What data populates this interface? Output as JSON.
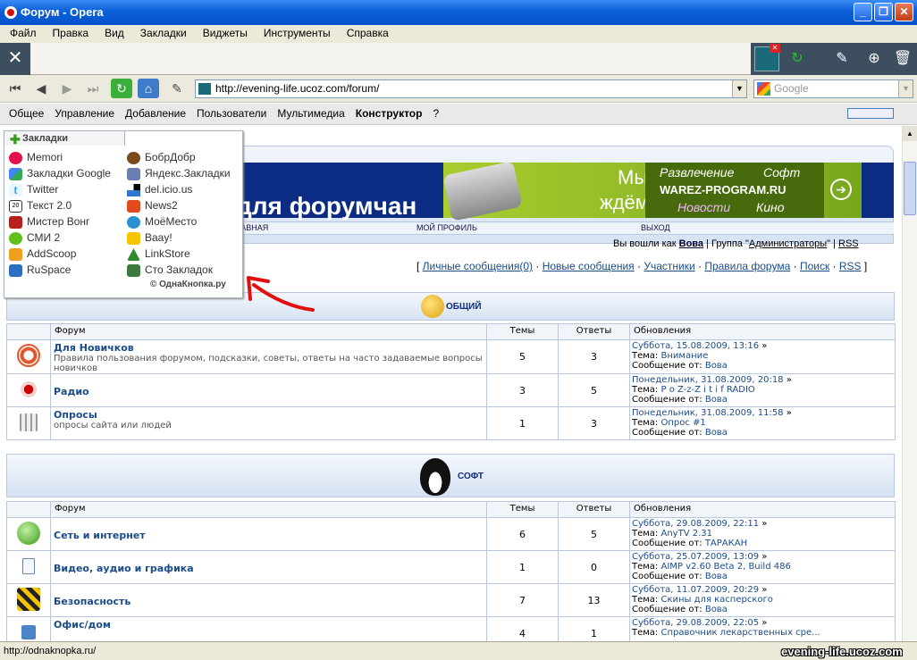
{
  "window": {
    "title": "Форум - Opera"
  },
  "menu": [
    "Файл",
    "Правка",
    "Вид",
    "Закладки",
    "Виджеты",
    "Инструменты",
    "Справка"
  ],
  "address": {
    "url": "http://evening-life.ucoz.com/forum/"
  },
  "search": {
    "placeholder": "Google"
  },
  "panel": {
    "items": [
      "Общее",
      "Управление",
      "Добавление",
      "Пользователи",
      "Мультимедиа",
      "Конструктор",
      "?"
    ]
  },
  "bookmarks": {
    "title": "Закладки",
    "left": [
      "Memori",
      "Закладки Google",
      "Twitter",
      "Текст 2.0",
      "Мистер Вонг",
      "СМИ 2",
      "AddScoop",
      "RuSpace"
    ],
    "right": [
      "БобрДобр",
      "Яндекс.Закладки",
      "del.icio.us",
      "News2",
      "МоёМесто",
      "Baay!",
      "LinkStore",
      "Сто Закладок"
    ],
    "footer": "© ОднаКнопка.ру"
  },
  "banner": {
    "slogan": "для форумчан",
    "ad_line1": "Мы",
    "ad_line2": "ждём вас",
    "ad_items": [
      "Развлечение",
      "Софт",
      "WAREZ-PROGRAM.RU",
      "Новости",
      "Кино"
    ]
  },
  "sitenav": [
    "ГЛАВНАЯ",
    "МОЙ ПРОФИЛЬ",
    "ВЫХОД"
  ],
  "user": {
    "prefix": "Вы вошли как",
    "name": "Вова",
    "group_label": "Группа",
    "group": "Администраторы",
    "rss": "RSS"
  },
  "links": [
    "Личные сообщения(0)",
    "Новые сообщения",
    "Участники",
    "Правила форума",
    "Поиск",
    "RSS"
  ],
  "columns": {
    "forum": "Форум",
    "topics": "Темы",
    "replies": "Ответы",
    "updates": "Обновления"
  },
  "labels": {
    "topic": "Тема:",
    "msg_from": "Сообщение от:"
  },
  "sections": [
    {
      "title": "ОБЩИЙ",
      "forums": [
        {
          "name": "Для Новичков",
          "desc": "Правила пользования форумом, подсказки, советы, ответы на часто задаваемые вопросы новичков",
          "topics": "5",
          "replies": "3",
          "date": "Суббота, 15.08.2009, 13:16",
          "topic": "Внимание",
          "author": "Вова"
        },
        {
          "name": "Радио",
          "desc": "",
          "topics": "3",
          "replies": "5",
          "date": "Понедельник, 31.08.2009, 20:18",
          "topic": "P o Z-z-Z i t i f RADIO",
          "author": "Вова"
        },
        {
          "name": "Опросы",
          "desc": "опросы сайта или людей",
          "topics": "1",
          "replies": "3",
          "date": "Понедельник, 31.08.2009, 11:58",
          "topic": "Опрос #1",
          "author": "Вова"
        }
      ]
    },
    {
      "title": "СОФТ",
      "forums": [
        {
          "name": "Сеть и интернет",
          "desc": "",
          "topics": "6",
          "replies": "5",
          "date": "Суббота, 29.08.2009, 22:11",
          "topic": "AnyTV 2.31",
          "author": "ТАРАКАН"
        },
        {
          "name": "Видео, аудио и графика",
          "desc": "",
          "topics": "1",
          "replies": "0",
          "date": "Суббота, 25.07.2009, 13:09",
          "topic": "AIMP v2.60 Beta 2, Build 486",
          "author": "Вова"
        },
        {
          "name": "Безопасность",
          "desc": "",
          "topics": "7",
          "replies": "13",
          "date": "Суббота, 11.07.2009, 20:29",
          "topic": "Скины для касперского",
          "author": "Вова"
        },
        {
          "name": "Офис/дом",
          "desc": "",
          "topics": "4",
          "replies": "1",
          "date": "Суббота, 29.08.2009, 22:05",
          "topic": "Справочник лекарственных сре...",
          "author": ""
        }
      ]
    }
  ],
  "status": {
    "text": "http://odnaknopka.ru/"
  },
  "watermark": "evening-life.ucoz.com"
}
